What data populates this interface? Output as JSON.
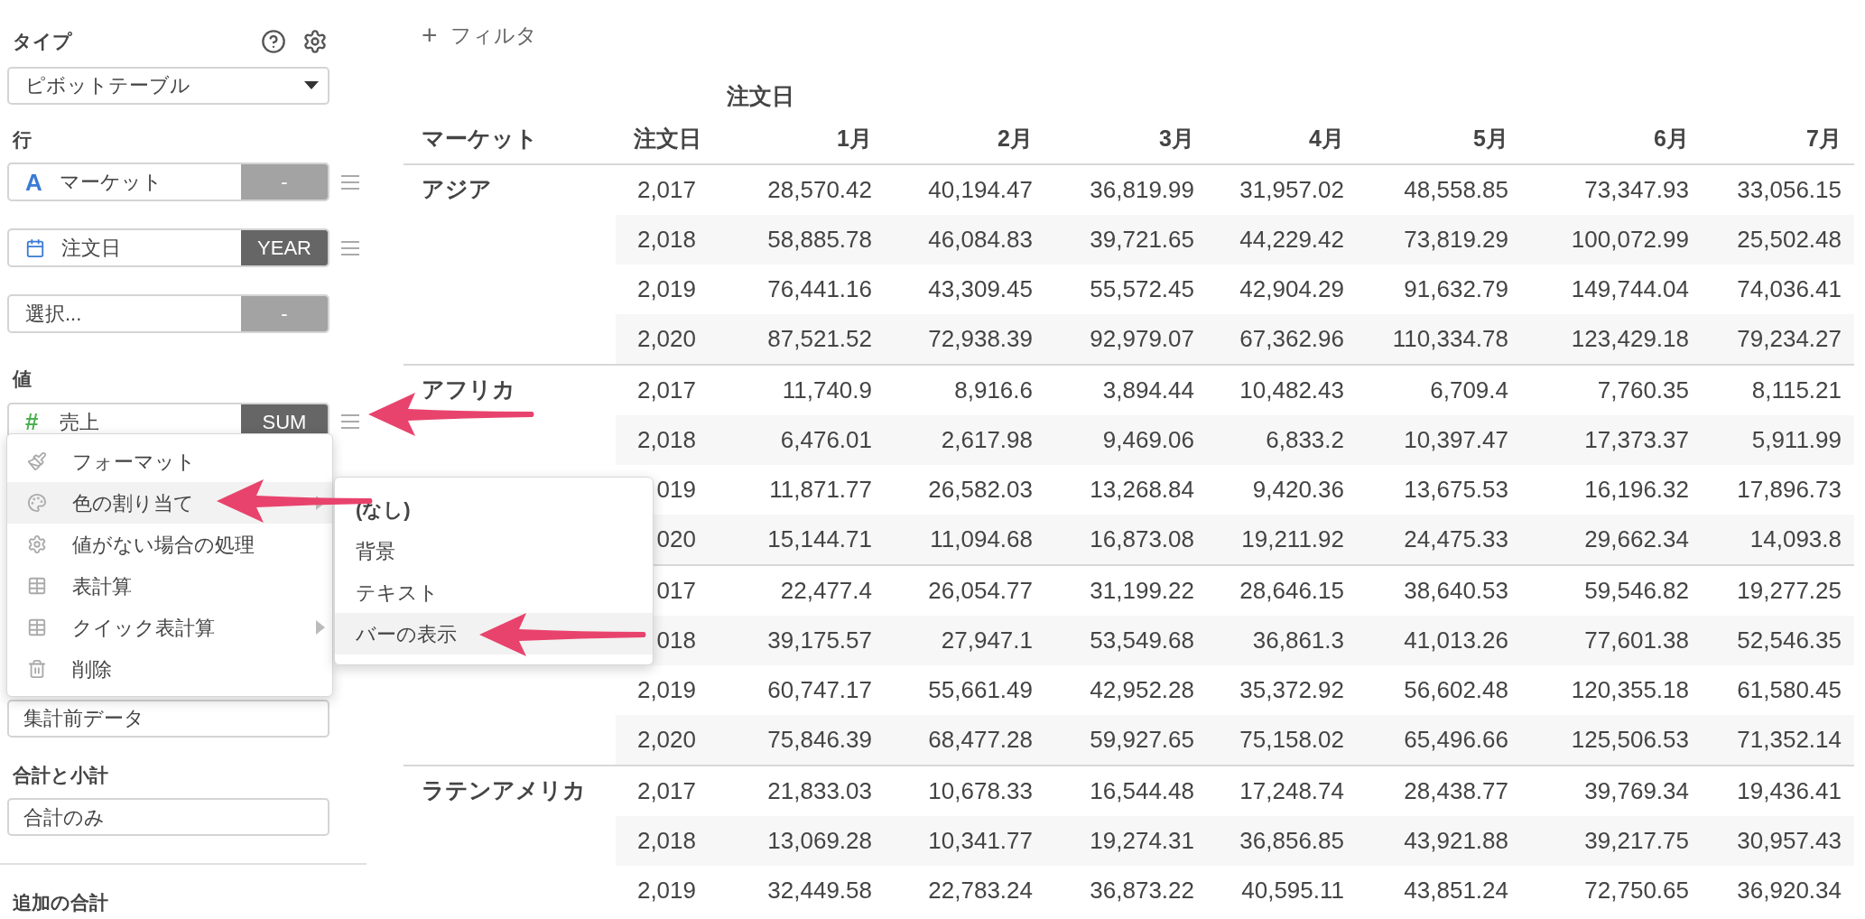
{
  "sidebar": {
    "type_label": "タイプ",
    "type_select": "ピボットテーブル",
    "rows_label": "行",
    "row_fields": [
      {
        "kind": "text",
        "glyph": "A",
        "label": "マーケット",
        "agg": "-",
        "agg_set": false
      },
      {
        "kind": "date",
        "label": "注文日",
        "agg": "YEAR",
        "agg_set": true
      },
      {
        "kind": "empty",
        "label": "選択...",
        "agg": "-",
        "agg_set": false
      }
    ],
    "values_label": "値",
    "value_fields": [
      {
        "kind": "number",
        "glyph": "#",
        "label": "売上",
        "agg": "SUM",
        "agg_set": true
      }
    ],
    "field_after_menu": "集計前データ",
    "totals_label": "合計と小計",
    "totals_select": "合計のみ",
    "extra_totals_label": "追加の合計"
  },
  "context_menu": {
    "items": [
      {
        "kind": "format",
        "label": "フォーマット",
        "selected": false,
        "submenu": false
      },
      {
        "kind": "color",
        "label": "色の割り当て",
        "selected": true,
        "submenu": true
      },
      {
        "kind": "missing",
        "label": "値がない場合の処理",
        "selected": false,
        "submenu": false
      },
      {
        "kind": "calc",
        "label": "表計算",
        "selected": false,
        "submenu": false
      },
      {
        "kind": "calc",
        "label": "クイック表計算",
        "selected": false,
        "submenu": true
      },
      {
        "kind": "delete",
        "label": "削除",
        "selected": false,
        "submenu": false
      }
    ],
    "submenu": [
      {
        "label": "(なし)",
        "current": true,
        "selected": false
      },
      {
        "label": "背景",
        "current": false,
        "selected": false
      },
      {
        "label": "テキスト",
        "current": false,
        "selected": false
      },
      {
        "label": "バーの表示",
        "current": false,
        "selected": true
      }
    ]
  },
  "filter_button": {
    "icon": "+",
    "label": "フィルタ"
  },
  "table": {
    "super_header": "注文日",
    "columns": [
      "マーケット",
      "注文日",
      "1月",
      "2月",
      "3月",
      "4月",
      "5月",
      "6月",
      "7月"
    ],
    "groups": [
      {
        "market": "アジア",
        "rows": [
          {
            "year": "2,017",
            "values": [
              "28,570.42",
              "40,194.47",
              "36,819.99",
              "31,957.02",
              "48,558.85",
              "73,347.93",
              "33,056.15"
            ]
          },
          {
            "year": "2,018",
            "values": [
              "58,885.78",
              "46,084.83",
              "39,721.65",
              "44,229.42",
              "73,819.29",
              "100,072.99",
              "25,502.48"
            ]
          },
          {
            "year": "2,019",
            "values": [
              "76,441.16",
              "43,309.45",
              "55,572.45",
              "42,904.29",
              "91,632.79",
              "149,744.04",
              "74,036.41"
            ]
          },
          {
            "year": "2,020",
            "values": [
              "87,521.52",
              "72,938.39",
              "92,979.07",
              "67,362.96",
              "110,334.78",
              "123,429.18",
              "79,234.27"
            ]
          }
        ]
      },
      {
        "market": "アフリカ",
        "rows": [
          {
            "year": "2,017",
            "values": [
              "11,740.9",
              "8,916.6",
              "3,894.44",
              "10,482.43",
              "6,709.4",
              "7,760.35",
              "8,115.21"
            ]
          },
          {
            "year": "2,018",
            "values": [
              "6,476.01",
              "2,617.98",
              "9,469.06",
              "6,833.2",
              "10,397.47",
              "17,373.37",
              "5,911.99"
            ]
          },
          {
            "year": "019",
            "values": [
              "11,871.77",
              "26,582.03",
              "13,268.84",
              "9,420.36",
              "13,675.53",
              "16,196.32",
              "17,896.73"
            ]
          },
          {
            "year": "020",
            "values": [
              "15,144.71",
              "11,094.68",
              "16,873.08",
              "19,211.92",
              "24,475.33",
              "29,662.34",
              "14,093.8"
            ]
          }
        ]
      },
      {
        "rows": [
          {
            "year": "017",
            "values": [
              "22,477.4",
              "26,054.77",
              "31,199.22",
              "28,646.15",
              "38,640.53",
              "59,546.82",
              "19,277.25"
            ]
          },
          {
            "year": "018",
            "values": [
              "39,175.57",
              "27,947.1",
              "53,549.68",
              "36,861.3",
              "41,013.26",
              "77,601.38",
              "52,546.35"
            ]
          },
          {
            "year": "2,019",
            "values": [
              "60,747.17",
              "55,661.49",
              "42,952.28",
              "35,372.92",
              "56,602.48",
              "120,355.18",
              "61,580.45"
            ]
          },
          {
            "year": "2,020",
            "values": [
              "75,846.39",
              "68,477.28",
              "59,927.65",
              "75,158.02",
              "65,496.66",
              "125,506.53",
              "71,352.14"
            ]
          }
        ]
      },
      {
        "market": "ラテンアメリカ",
        "rows": [
          {
            "year": "2,017",
            "values": [
              "21,833.03",
              "10,678.33",
              "16,544.48",
              "17,248.74",
              "28,438.77",
              "39,769.34",
              "19,436.41"
            ]
          },
          {
            "year": "2,018",
            "values": [
              "13,069.28",
              "10,341.77",
              "19,274.31",
              "36,856.85",
              "43,921.88",
              "39,217.75",
              "30,957.43"
            ]
          },
          {
            "year": "2,019",
            "values": [
              "32,449.58",
              "22,783.24",
              "36,873.22",
              "40,595.11",
              "43,851.24",
              "72,750.65",
              "36,920.34"
            ]
          }
        ]
      }
    ]
  }
}
